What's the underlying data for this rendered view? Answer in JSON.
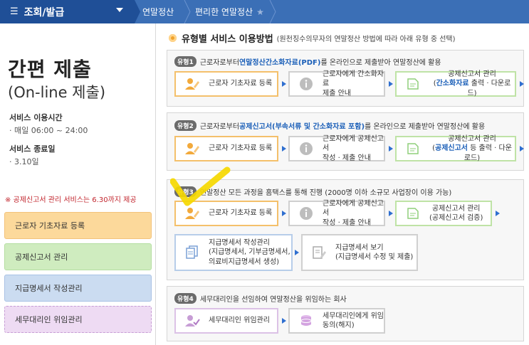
{
  "topbar": {
    "menu_label": "조회/발급",
    "crumb1": "연말정산",
    "crumb2": "편리한 연말정산"
  },
  "left": {
    "title_main": "간편 제출",
    "title_sub": "(On-line 제출)",
    "service_time_label": "서비스 이용시간",
    "service_time_value": "· 매일 06:00 ~ 24:00",
    "service_end_label": "서비스 종료일",
    "service_end_value": "· 3.10일",
    "notice": "※ 공제신고서 관리 서비스는 6.30까지 제공",
    "buttons": [
      "근로자 기초자료 등록",
      "공제신고서 관리",
      "지급명세서 작성관리",
      "세무대리인 위임관리"
    ]
  },
  "main": {
    "section_title": "유형별 서비스 이용방법",
    "section_sub": "(원천징수의무자의 연말정산 방법에 따라 아래 유형 중 선택)",
    "types": [
      {
        "tag": "유형1",
        "desc_pre": "근로자로부터 ",
        "desc_hl": "연말정산간소화자료(PDF)",
        "desc_post": "를 온라인으로 제출받아 연말정산에 활용",
        "step1": "근로자 기초자료 등록",
        "step2_l1": "근로자에게 간소화자료",
        "step2_l2": "제출 안내",
        "step3_l1": "공제신고서 관리",
        "step3_hl": "간소화자료",
        "step3_post": " 출력 · 다운로드)"
      },
      {
        "tag": "유형2",
        "desc_pre": "근로자로부터 ",
        "desc_hl": "공제신고서(부속서류 및 간소화자료 포함)",
        "desc_post": "를 온라인으로 제출받아 연말정산에 활용",
        "step1": "근로자 기초자료 등록",
        "step2_l1": "근로자에게 공제신고서",
        "step2_l2": "작성 · 제출 안내",
        "step3_l1": "공제신고서 관리",
        "step3_hl": "공제신고서",
        "step3_post": " 등 출력 · 다운로드)"
      },
      {
        "tag": "유형3",
        "desc": "연말정산 모든 과정을 홈택스를 통해 진행 (2000명 이하 소규모 사업장이 이용 가능)",
        "step1": "근로자 기초자료 등록",
        "step2_l1": "근로자에게 공제신고서",
        "step2_l2": "작성 · 제출 안내",
        "step3_l1": "공제신고서 관리",
        "step3_l2": "(공제신고서 검증)",
        "step4_l1": "지급명세서 작성관리",
        "step4_l2": "(지급명세서, 기부금명세서,",
        "step4_l3": "의료비지급명세서 생성)",
        "step5_l1": "지급명세서 보기",
        "step5_l2": "(지급명세서 수정 및 제출)"
      },
      {
        "tag": "유형4",
        "desc": "세무대리인을 선임하여 연말정산을 위임하는 회사",
        "step1": "세무대리인 위임관리",
        "step2_l1": "세무대리인에게 위임",
        "step2_l2": "동의(해지)"
      }
    ]
  },
  "colors": {
    "topbar": "#3b6fb6",
    "menu": "#1f4f97",
    "highlight": "#1b5fb8",
    "notice": "#c2262e",
    "check": "#f5d800"
  }
}
